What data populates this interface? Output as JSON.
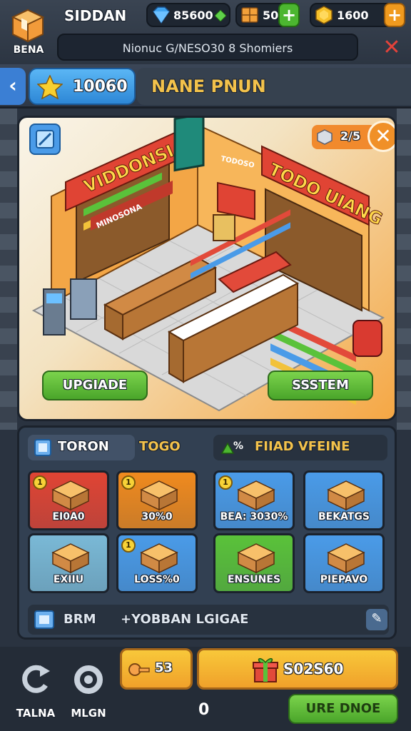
{
  "top_bar": {
    "shop_label": "BENA",
    "player_name": "SIDDAN",
    "gems": "85600",
    "boxes": "50",
    "coins": "1600",
    "message": "Nionuc  G/NESO30  8  Shomiers",
    "icons": {
      "shop": "shop-box-icon",
      "gem": "gem-icon",
      "box": "crate-icon",
      "coin": "coin-icon",
      "close": "close-icon"
    },
    "colors": {
      "plus_green": "#4cb630",
      "plus_orange": "#f09a1e",
      "close_red": "#e4423a"
    }
  },
  "sub_header": {
    "back_icon": "chevron-left-icon",
    "stars": "10060",
    "store_name": "NANE PNUN"
  },
  "scene": {
    "sign_left": "VIDDONSIA",
    "sign_left_sub": "MINOSONA",
    "sign_right": "TODO UIANG",
    "sign_middle": "TODOSO",
    "timer": "2/5",
    "upgrade_label": "UPGIADE",
    "system_label": "SSSTEM"
  },
  "panel": {
    "tab1": "TORON",
    "tab2": "TOGO",
    "tab3": "FIIAD VFEINE",
    "tab3_prefix": "%",
    "cards": [
      {
        "label": "EI0A0",
        "badge": "1",
        "color": "#e04434"
      },
      {
        "label": "30%0",
        "badge": "1",
        "color": "#f08a1e"
      },
      {
        "label": "BEA: 3030%",
        "badge": "1",
        "color": "#4a9be8"
      },
      {
        "label": "BEKATGS",
        "badge": "",
        "color": "#4a9be8"
      },
      {
        "label": "EXIIU",
        "badge": "",
        "color": "#7ab9d6"
      },
      {
        "label": "LOSS%0",
        "badge": "1",
        "color": "#4a9be8"
      },
      {
        "label": "ENSUNES",
        "badge": "",
        "color": "#5ac23a"
      },
      {
        "label": "PIEPAVO",
        "badge": "",
        "color": "#4a9be8"
      }
    ],
    "bottom_label1": "BRM",
    "bottom_label2": "+YOBBAN LGIGAE"
  },
  "bottom_nav": {
    "nav1_label": "TALNA",
    "nav2_label": "MLGN",
    "key_value": "53",
    "buy_value": "S02S60",
    "count": "0",
    "more_label": "URE DNOE"
  }
}
